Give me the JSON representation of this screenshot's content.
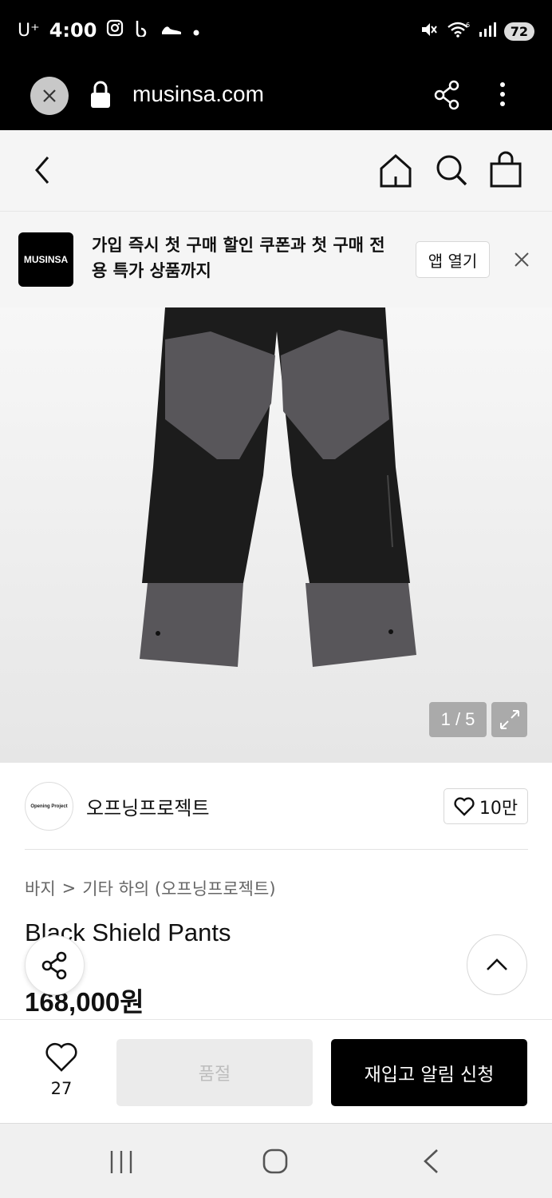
{
  "status_bar": {
    "carrier": "U⁺",
    "time": "4:00",
    "battery": "72",
    "wifi_gen": "6"
  },
  "browser": {
    "url": "musinsa.com"
  },
  "banner": {
    "logo_text": "MUSINSA",
    "message": "가입 즉시 첫 구매 할인 쿠폰과 첫 구매 전용 특가 상품까지",
    "open_app_label": "앱 열기"
  },
  "gallery": {
    "counter": "1 / 5"
  },
  "brand": {
    "avatar_text": "Opening Project",
    "name": "오프닝프로젝트",
    "likes": "10만"
  },
  "product": {
    "breadcrumb_category": "바지",
    "breadcrumb_separator": ">",
    "breadcrumb_sub": "기타 하의 (오프닝프로젝트)",
    "title": "Black Shield Pants",
    "price": "168,000원"
  },
  "actions": {
    "wish_count": "27",
    "soldout_label": "품절",
    "restock_label": "재입고 알림 신청"
  },
  "colors": {
    "bar_black": "#000000",
    "pants_black": "#1c1c1c",
    "pants_gray": "#58565a"
  }
}
